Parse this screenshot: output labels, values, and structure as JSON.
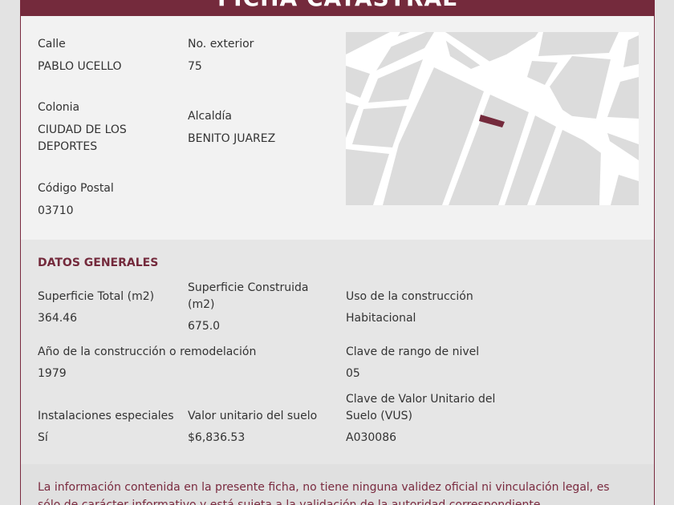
{
  "header": {
    "title": "FICHA CATASTRAL"
  },
  "address": {
    "calle_label": "Calle",
    "calle_value": "PABLO UCELLO",
    "no_ext_label": "No. exterior",
    "no_ext_value": "75",
    "colonia_label": "Colonia",
    "colonia_value": "CIUDAD DE LOS DEPORTES",
    "alcaldia_label": "Alcaldía",
    "alcaldia_value": "BENITO JUAREZ",
    "cp_label": "Código Postal",
    "cp_value": "03710"
  },
  "map": {
    "highlight_color": "#742a3c",
    "block_color": "#dcdcdc",
    "street_color": "#ffffff"
  },
  "general": {
    "title": "DATOS GENERALES",
    "sup_total_label": "Superficie Total (m2)",
    "sup_total_value": "364.46",
    "sup_const_label": "Superficie Construida (m2)",
    "sup_const_value": "675.0",
    "uso_label": "Uso de la construcción",
    "uso_value": "Habitacional",
    "anio_label": "Año de la construcción o remodelación",
    "anio_value": "1979",
    "rango_label": "Clave de rango de nivel",
    "rango_value": "05",
    "inst_label": "Instalaciones especiales",
    "inst_value": "Sí",
    "valor_label": "Valor unitario del suelo",
    "valor_value": "$6,836.53",
    "vus_label": "Clave de Valor Unitario del Suelo (VUS)",
    "vus_value": "A030086"
  },
  "footer": {
    "disclaimer": "La información contenida en la presente ficha, no tiene ninguna validez oficial ni vinculación legal, es sólo de carácter informativo y está sujeta a la validación de la autoridad correspondiente."
  }
}
